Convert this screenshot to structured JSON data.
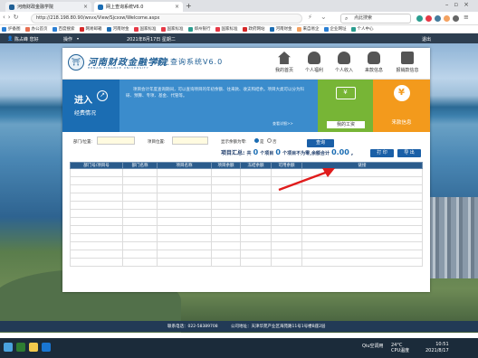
{
  "browser": {
    "tabs": [
      {
        "title": "河南财政金融学院",
        "active": false
      },
      {
        "title": "网上查询系统V6.0",
        "active": true
      }
    ],
    "url": "http://218.198.80.90/wsvx/View/Sjcxsw/Welcome.aspx",
    "search_placeholder": "点此搜索",
    "bookmarks": [
      "护备图",
      "办公首页",
      "百度搜索",
      "网易邮箱",
      "河南财金",
      "国家标准",
      "国家标准",
      "郑州银行",
      "国家标准",
      "政府网站",
      "河南财金",
      "来自易企",
      "企业网址",
      "个人中心"
    ]
  },
  "appbar": {
    "user_label": "陈占峰 您好",
    "menu_label": "操作",
    "date": "2021年8月17日 星期二",
    "logout": "退出"
  },
  "logo": {
    "cn": "河南财政金融学院",
    "en": "HENAN FINANCE UNIVERSITY",
    "system": "网上查询系统V6.0"
  },
  "nav": [
    "我的首页",
    "个人福利",
    "个人收入",
    "来款信息",
    "报销款信息"
  ],
  "banner": {
    "enter": "进入",
    "sub": "经费情况",
    "text": "项目会计年度查询期间，可以查询项目的年初余额、往来款、收支和结余。项目大类可以分为科研、预算、专项、基金、代管等。",
    "more": "查看详细>>",
    "tile_salary": "我的工资",
    "tile_expense": "来款信息"
  },
  "filter": {
    "dept_label": "部门/位置:",
    "project_label": "项目位置:",
    "zero_label": "显示余额为零:",
    "opt_yes": "是",
    "opt_no": "否",
    "query": "查询"
  },
  "summary": {
    "label": "项目汇总:",
    "part1_pre": "共",
    "count1": "0",
    "part1_post": "个项目",
    "count2": "0",
    "part2_post": "个项目不为零,余额合计",
    "total": "0.00",
    "comma": ",",
    "print": "打 印",
    "export": "导 出"
  },
  "table": {
    "headers": [
      "部门号/项目号",
      "部门名称",
      "项目名称",
      "项目余额",
      "冻结余额",
      "可用余额",
      "链接"
    ]
  },
  "footer": {
    "phone": "联系电话：022-58389708",
    "address": "公司地址：天津华苑产业区海苑路11号1号楼B座2层"
  },
  "taskbar": {
    "weather_temp": "24°C",
    "weather_desc": "CPU温度",
    "tray_left": "Qiu空调用",
    "time": "10:51",
    "date": "2021/8/17"
  },
  "colors": {
    "nav_blue": "#1b6db3",
    "green": "#77b536",
    "orange": "#f39a1c",
    "header_dark": "#2d3e50"
  }
}
